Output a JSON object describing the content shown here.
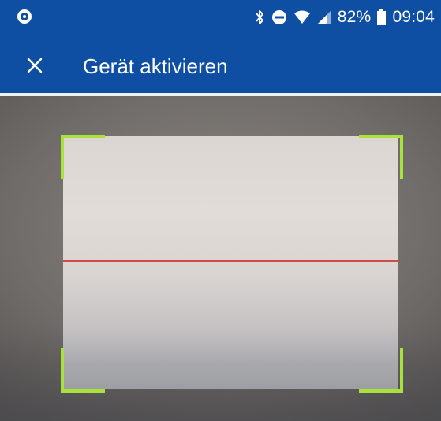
{
  "status_bar": {
    "left_icon": "app-notification-icon",
    "icons": [
      "bluetooth-icon",
      "do-not-disturb-icon",
      "wifi-icon",
      "signal-icon"
    ],
    "battery_percent": "82%",
    "battery_icon": "battery-icon",
    "time": "09:04"
  },
  "app_bar": {
    "close_icon": "close-icon",
    "title": "Gerät aktivieren"
  },
  "scanner": {
    "frame_color": "#a9e23a",
    "scan_line_color": "#d24a4a"
  },
  "colors": {
    "primary": "#0e4fa3"
  }
}
